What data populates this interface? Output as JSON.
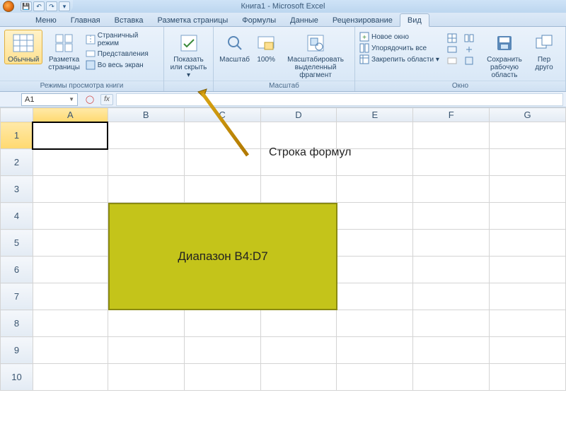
{
  "title": "Книга1 - Microsoft Excel",
  "tabs": {
    "menu": "Меню",
    "home": "Главная",
    "insert": "Вставка",
    "layout": "Разметка страницы",
    "formulas": "Формулы",
    "data": "Данные",
    "review": "Рецензирование",
    "view": "Вид"
  },
  "ribbon": {
    "views": {
      "normal": "Обычный",
      "page_layout": "Разметка\nстраницы",
      "page_break": "Страничный режим",
      "custom_views": "Представления",
      "full_screen": "Во весь экран",
      "group_label": "Режимы просмотра книги"
    },
    "showhide": {
      "label": "Показать\nили скрыть ▾"
    },
    "zoom": {
      "zoom": "Масштаб",
      "p100": "100%",
      "selection": "Масштабировать\nвыделенный фрагмент",
      "group_label": "Масштаб"
    },
    "window": {
      "new": "Новое окно",
      "arrange": "Упорядочить все",
      "freeze": "Закрепить области ▾",
      "save_ws": "Сохранить\nрабочую область",
      "other": "Пер\nдруго",
      "group_label": "Окно"
    }
  },
  "namebox": "A1",
  "fx_label": "fx",
  "columns": [
    "A",
    "B",
    "C",
    "D",
    "E",
    "F",
    "G"
  ],
  "rows": [
    "1",
    "2",
    "3",
    "4",
    "5",
    "6",
    "7",
    "8",
    "9",
    "10"
  ],
  "active_cell": "A1",
  "annotation": {
    "formula_bar": "Строка формул",
    "range_label": "Диапазон B4:D7"
  }
}
